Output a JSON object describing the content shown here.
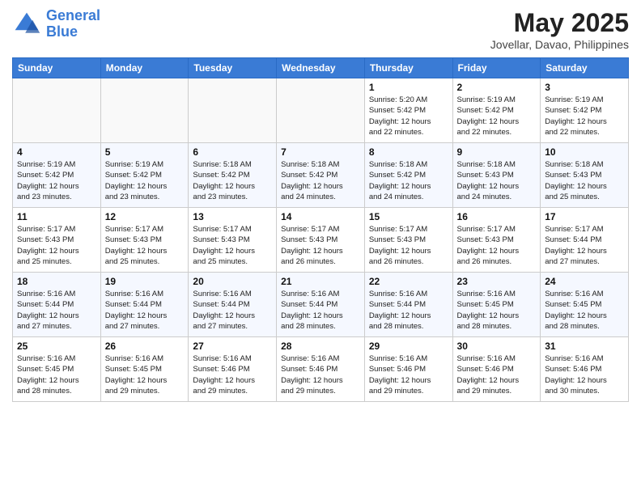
{
  "header": {
    "logo_line1": "General",
    "logo_line2": "Blue",
    "month": "May 2025",
    "location": "Jovellar, Davao, Philippines"
  },
  "weekdays": [
    "Sunday",
    "Monday",
    "Tuesday",
    "Wednesday",
    "Thursday",
    "Friday",
    "Saturday"
  ],
  "weeks": [
    [
      {
        "day": "",
        "info": ""
      },
      {
        "day": "",
        "info": ""
      },
      {
        "day": "",
        "info": ""
      },
      {
        "day": "",
        "info": ""
      },
      {
        "day": "1",
        "info": "Sunrise: 5:20 AM\nSunset: 5:42 PM\nDaylight: 12 hours\nand 22 minutes."
      },
      {
        "day": "2",
        "info": "Sunrise: 5:19 AM\nSunset: 5:42 PM\nDaylight: 12 hours\nand 22 minutes."
      },
      {
        "day": "3",
        "info": "Sunrise: 5:19 AM\nSunset: 5:42 PM\nDaylight: 12 hours\nand 22 minutes."
      }
    ],
    [
      {
        "day": "4",
        "info": "Sunrise: 5:19 AM\nSunset: 5:42 PM\nDaylight: 12 hours\nand 23 minutes."
      },
      {
        "day": "5",
        "info": "Sunrise: 5:19 AM\nSunset: 5:42 PM\nDaylight: 12 hours\nand 23 minutes."
      },
      {
        "day": "6",
        "info": "Sunrise: 5:18 AM\nSunset: 5:42 PM\nDaylight: 12 hours\nand 23 minutes."
      },
      {
        "day": "7",
        "info": "Sunrise: 5:18 AM\nSunset: 5:42 PM\nDaylight: 12 hours\nand 24 minutes."
      },
      {
        "day": "8",
        "info": "Sunrise: 5:18 AM\nSunset: 5:42 PM\nDaylight: 12 hours\nand 24 minutes."
      },
      {
        "day": "9",
        "info": "Sunrise: 5:18 AM\nSunset: 5:43 PM\nDaylight: 12 hours\nand 24 minutes."
      },
      {
        "day": "10",
        "info": "Sunrise: 5:18 AM\nSunset: 5:43 PM\nDaylight: 12 hours\nand 25 minutes."
      }
    ],
    [
      {
        "day": "11",
        "info": "Sunrise: 5:17 AM\nSunset: 5:43 PM\nDaylight: 12 hours\nand 25 minutes."
      },
      {
        "day": "12",
        "info": "Sunrise: 5:17 AM\nSunset: 5:43 PM\nDaylight: 12 hours\nand 25 minutes."
      },
      {
        "day": "13",
        "info": "Sunrise: 5:17 AM\nSunset: 5:43 PM\nDaylight: 12 hours\nand 25 minutes."
      },
      {
        "day": "14",
        "info": "Sunrise: 5:17 AM\nSunset: 5:43 PM\nDaylight: 12 hours\nand 26 minutes."
      },
      {
        "day": "15",
        "info": "Sunrise: 5:17 AM\nSunset: 5:43 PM\nDaylight: 12 hours\nand 26 minutes."
      },
      {
        "day": "16",
        "info": "Sunrise: 5:17 AM\nSunset: 5:43 PM\nDaylight: 12 hours\nand 26 minutes."
      },
      {
        "day": "17",
        "info": "Sunrise: 5:17 AM\nSunset: 5:44 PM\nDaylight: 12 hours\nand 27 minutes."
      }
    ],
    [
      {
        "day": "18",
        "info": "Sunrise: 5:16 AM\nSunset: 5:44 PM\nDaylight: 12 hours\nand 27 minutes."
      },
      {
        "day": "19",
        "info": "Sunrise: 5:16 AM\nSunset: 5:44 PM\nDaylight: 12 hours\nand 27 minutes."
      },
      {
        "day": "20",
        "info": "Sunrise: 5:16 AM\nSunset: 5:44 PM\nDaylight: 12 hours\nand 27 minutes."
      },
      {
        "day": "21",
        "info": "Sunrise: 5:16 AM\nSunset: 5:44 PM\nDaylight: 12 hours\nand 28 minutes."
      },
      {
        "day": "22",
        "info": "Sunrise: 5:16 AM\nSunset: 5:44 PM\nDaylight: 12 hours\nand 28 minutes."
      },
      {
        "day": "23",
        "info": "Sunrise: 5:16 AM\nSunset: 5:45 PM\nDaylight: 12 hours\nand 28 minutes."
      },
      {
        "day": "24",
        "info": "Sunrise: 5:16 AM\nSunset: 5:45 PM\nDaylight: 12 hours\nand 28 minutes."
      }
    ],
    [
      {
        "day": "25",
        "info": "Sunrise: 5:16 AM\nSunset: 5:45 PM\nDaylight: 12 hours\nand 28 minutes."
      },
      {
        "day": "26",
        "info": "Sunrise: 5:16 AM\nSunset: 5:45 PM\nDaylight: 12 hours\nand 29 minutes."
      },
      {
        "day": "27",
        "info": "Sunrise: 5:16 AM\nSunset: 5:46 PM\nDaylight: 12 hours\nand 29 minutes."
      },
      {
        "day": "28",
        "info": "Sunrise: 5:16 AM\nSunset: 5:46 PM\nDaylight: 12 hours\nand 29 minutes."
      },
      {
        "day": "29",
        "info": "Sunrise: 5:16 AM\nSunset: 5:46 PM\nDaylight: 12 hours\nand 29 minutes."
      },
      {
        "day": "30",
        "info": "Sunrise: 5:16 AM\nSunset: 5:46 PM\nDaylight: 12 hours\nand 29 minutes."
      },
      {
        "day": "31",
        "info": "Sunrise: 5:16 AM\nSunset: 5:46 PM\nDaylight: 12 hours\nand 30 minutes."
      }
    ]
  ]
}
